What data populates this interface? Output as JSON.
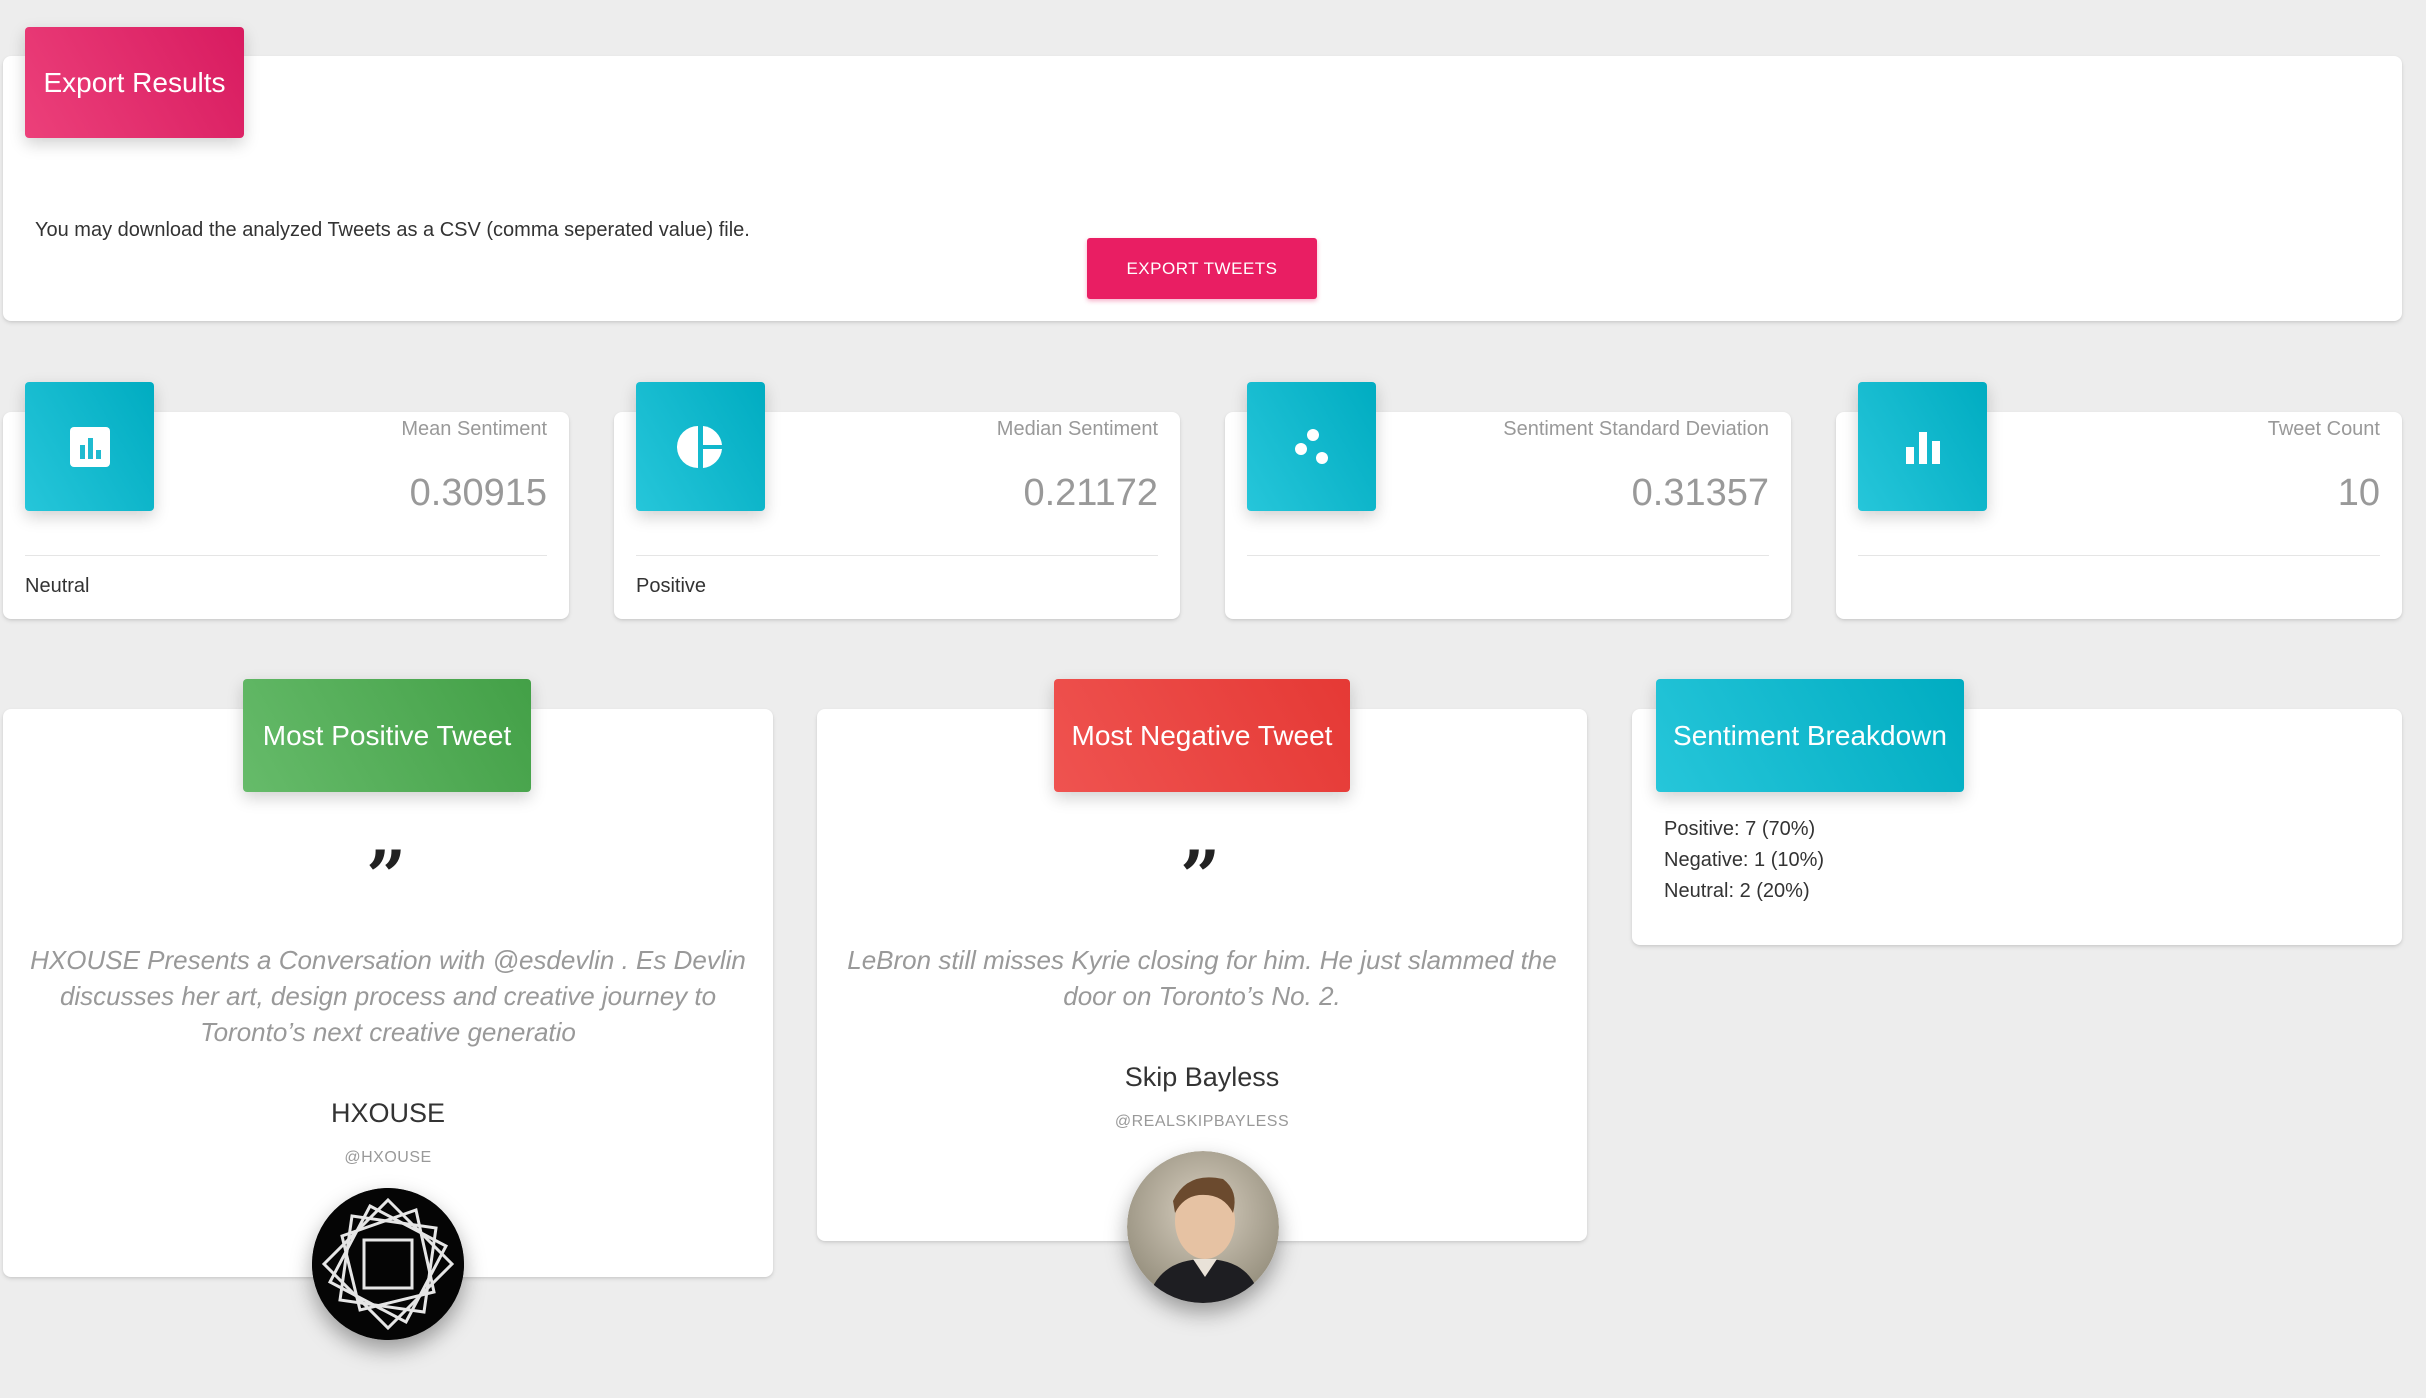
{
  "export": {
    "header": "Export Results",
    "description": "You may download the analyzed Tweets as a CSV (comma seperated value) file.",
    "button_label": "EXPORT TWEETS"
  },
  "stats": [
    {
      "icon": "bar-chart-icon",
      "title": "Mean Sentiment",
      "value": "0.30915",
      "footer": "Neutral"
    },
    {
      "icon": "pie-chart-icon",
      "title": "Median Sentiment",
      "value": "0.21172",
      "footer": "Positive"
    },
    {
      "icon": "scatter-dots-icon",
      "title": "Sentiment Standard Deviation",
      "value": "0.31357",
      "footer": ""
    },
    {
      "icon": "bar-graph-icon",
      "title": "Tweet Count",
      "value": "10",
      "footer": ""
    }
  ],
  "positive_tweet": {
    "header": "Most Positive Tweet",
    "text_lines": [
      "HXOUSE Presents a Conversation with @esdevlin . Es Devlin",
      "discusses her art, design process and creative journey to",
      "Toronto’s next creative generatio"
    ],
    "name": "HXOUSE",
    "handle": "@HXOUSE"
  },
  "negative_tweet": {
    "header": "Most Negative Tweet",
    "text_lines": [
      "LeBron still misses Kyrie closing for him. He just slammed the",
      "door on Toronto’s No. 2."
    ],
    "name": "Skip Bayless",
    "handle": "@REALSKIPBAYLESS"
  },
  "breakdown": {
    "header": "Sentiment Breakdown",
    "lines": [
      "Positive: 7 (70%)",
      "Negative: 1 (10%)",
      "Neutral: 2 (20%)"
    ]
  },
  "colors": {
    "pink": "#e91e63",
    "cyan": "#00acc1",
    "green": "#43a047",
    "red": "#e53935",
    "background": "#ededed"
  }
}
